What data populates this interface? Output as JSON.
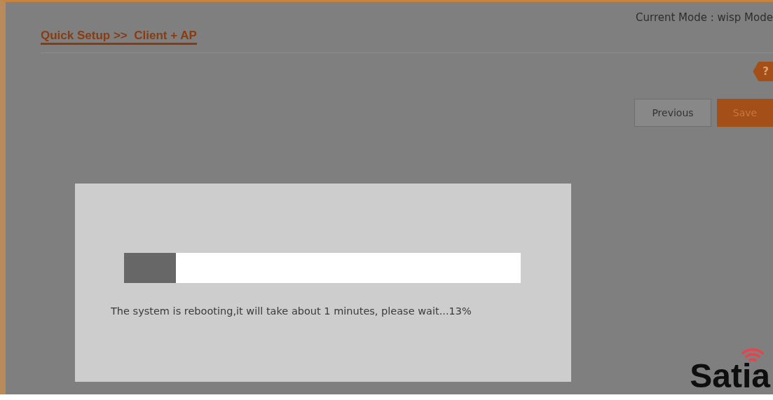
{
  "header": {
    "breadcrumb": "Quick Setup >>  Client + AP",
    "current_mode": "Current Mode : wisp Mode"
  },
  "help_tab": {
    "label": "?"
  },
  "buttons": [
    {
      "label": "Previous",
      "kind": "secondary"
    },
    {
      "label": "Save",
      "kind": "primary"
    }
  ],
  "dialog": {
    "progress": {
      "level": 0.13
    },
    "message": "The system is rebooting,it will take about 1 minutes, please wait...13%"
  },
  "logo": {
    "text": "Satia"
  }
}
